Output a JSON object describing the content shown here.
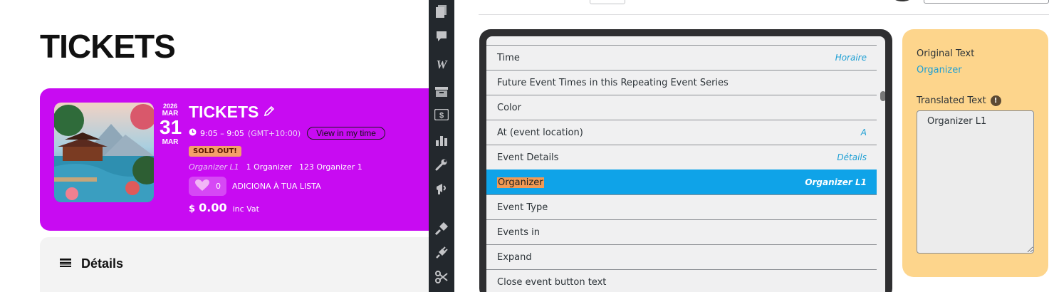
{
  "page": {
    "title": "TICKETS"
  },
  "event": {
    "year": "2026",
    "month_start": "MAR",
    "day": "31",
    "month_end": "MAR",
    "title": "TICKETS",
    "time": "9:05 – 9:05",
    "timezone": "(GMT+10:00)",
    "view_in_my_time": "View in my time",
    "status_badge": "SOLD OUT!",
    "organizers": [
      "Organizer L1",
      "1 Organizer",
      "123 Organizer 1"
    ],
    "favorite_count": "0",
    "add_to_list": "ADICIONA À TUA LISTA",
    "currency": "$",
    "price": "0.00",
    "price_note": "inc Vat",
    "card_color": "#c80bf2"
  },
  "details": {
    "label": "Détails"
  },
  "admin_toolbar": {
    "icons": [
      "pages-icon",
      "comments-icon",
      "woocommerce-icon",
      "archive-icon",
      "payments-icon",
      "analytics-icon",
      "tools-icon",
      "marketing-icon",
      "appearance-icon",
      "plugins-icon",
      "scissors-icon"
    ]
  },
  "strings": [
    {
      "original": "Time",
      "translation": "Horaire"
    },
    {
      "original": "Future Event Times in this Repeating Event Series",
      "translation": ""
    },
    {
      "original": "Color",
      "translation": ""
    },
    {
      "original": "At (event location)",
      "translation": "A"
    },
    {
      "original": "Event Details",
      "translation": "Détails"
    },
    {
      "original": "Organizer",
      "translation": "Organizer L1",
      "active": true
    },
    {
      "original": "Event Type",
      "translation": ""
    },
    {
      "original": "Events in",
      "translation": ""
    },
    {
      "original": "Expand",
      "translation": ""
    },
    {
      "original": "Close event button text",
      "translation": ""
    }
  ],
  "translation_panel": {
    "original_label": "Original Text",
    "original_value": "Organizer",
    "translated_label": "Translated Text",
    "translated_value": "Organizer L1"
  },
  "colors": {
    "accent_blue": "#0fa3e8",
    "highlight_orange": "#f29a54",
    "panel_yellow": "#fdd58c",
    "toolbar_dark": "#23282d"
  }
}
